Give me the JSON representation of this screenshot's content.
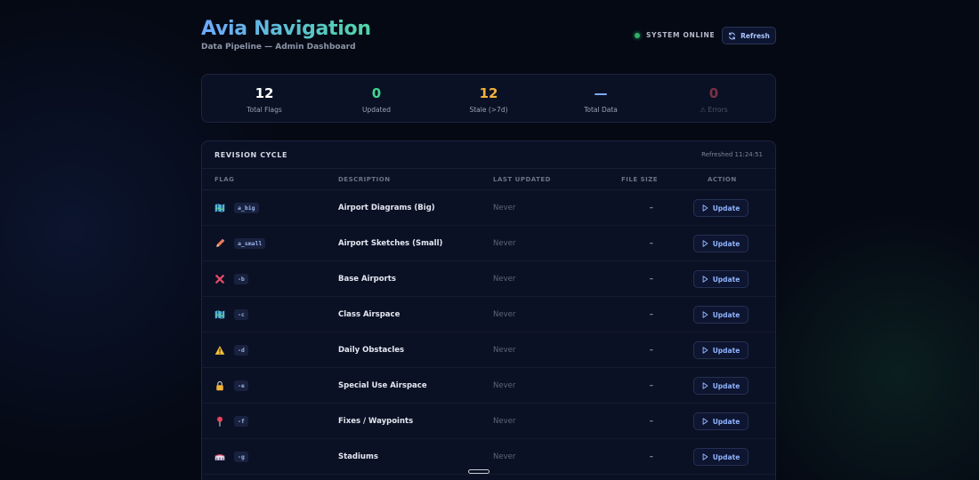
{
  "header": {
    "title": "Avia Navigation",
    "subtitle": "Data Pipeline — Admin Dashboard",
    "status": "SYSTEM ONLINE",
    "refresh_label": "Refresh"
  },
  "stats": [
    {
      "value": "12",
      "label": "Total Flags",
      "color": "#ffffff"
    },
    {
      "value": "0",
      "label": "Updated",
      "color": "#3fd68f"
    },
    {
      "value": "12",
      "label": "Stale (>7d)",
      "color": "#f2b13c"
    },
    {
      "value": "—",
      "label": "Total Data",
      "color": "#7fb0ff"
    },
    {
      "value": "0",
      "label": "⚠ Errors",
      "color": "#7a3146"
    }
  ],
  "panel": {
    "title": "REVISION CYCLE",
    "refreshed": "Refreshed 11:24:51",
    "columns": {
      "flag": "FLAG",
      "description": "DESCRIPTION",
      "last_updated": "LAST UPDATED",
      "file_size": "FILE SIZE",
      "action": "ACTION"
    },
    "rows": [
      {
        "icon": "map-icon",
        "code": "a_big",
        "description": "Airport Diagrams (Big)",
        "last_updated": "Never",
        "size": "–",
        "action": "Update"
      },
      {
        "icon": "pencil-icon",
        "code": "a_small",
        "description": "Airport Sketches (Small)",
        "last_updated": "Never",
        "size": "–",
        "action": "Update"
      },
      {
        "icon": "cross-icon",
        "code": "-b",
        "description": "Base Airports",
        "last_updated": "Never",
        "size": "–",
        "action": "Update"
      },
      {
        "icon": "map-icon",
        "code": "-c",
        "description": "Class Airspace",
        "last_updated": "Never",
        "size": "–",
        "action": "Update"
      },
      {
        "icon": "warning-icon",
        "code": "-d",
        "description": "Daily Obstacles",
        "last_updated": "Never",
        "size": "–",
        "action": "Update"
      },
      {
        "icon": "lock-icon",
        "code": "-e",
        "description": "Special Use Airspace",
        "last_updated": "Never",
        "size": "–",
        "action": "Update"
      },
      {
        "icon": "pin-icon",
        "code": "-f",
        "description": "Fixes / Waypoints",
        "last_updated": "Never",
        "size": "–",
        "action": "Update"
      },
      {
        "icon": "stadium-icon",
        "code": "-g",
        "description": "Stadiums",
        "last_updated": "Never",
        "size": "–",
        "action": "Update"
      }
    ]
  }
}
